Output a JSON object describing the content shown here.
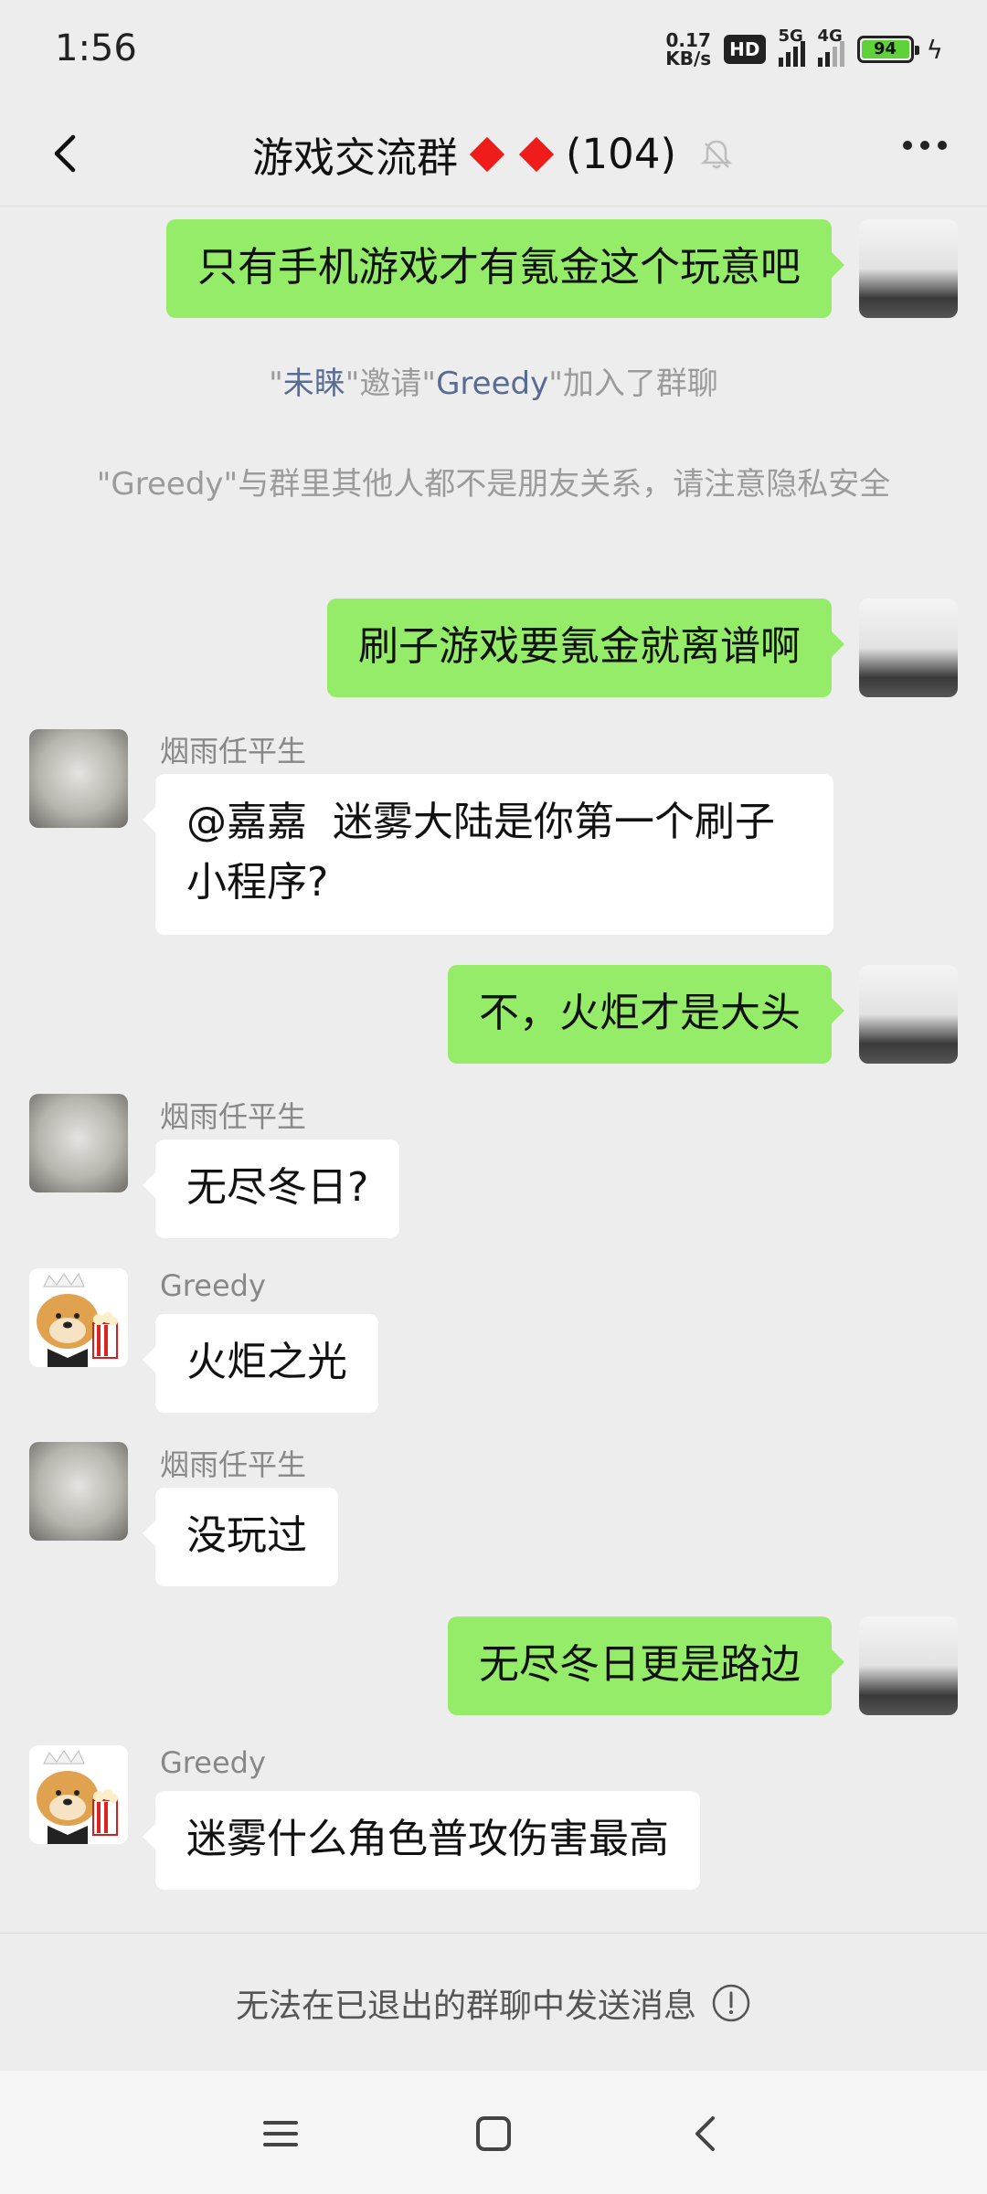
{
  "status": {
    "time": "1:56",
    "net_speed_top": "0.17",
    "net_speed_bottom": "KB/s",
    "hd": "HD",
    "signal1": "5G",
    "signal2": "4G",
    "battery": "94"
  },
  "header": {
    "title_prefix": "游戏交流群",
    "title_count": "(104)",
    "back_icon": "chevron-left-icon",
    "mute_icon": "bell-off-icon",
    "more_icon": "more-dots-icon"
  },
  "messages": {
    "m1": {
      "text": "只有手机游戏才有氪金这个玩意吧"
    },
    "sys1": {
      "q1": "\"",
      "inviter": "未睐",
      "q2": "\"邀请\"",
      "invitee": "Greedy",
      "q3": "\"加入了群聊"
    },
    "sys2": {
      "text": "\"Greedy\"与群里其他人都不是朋友关系，请注意隐私安全"
    },
    "m2": {
      "text": "刷子游戏要氪金就离谱啊"
    },
    "m3": {
      "sender": "烟雨任平生",
      "text": "@嘉嘉  迷雾大陆是你第一个刷子小程序?"
    },
    "m4": {
      "text": "不，火炬才是大头"
    },
    "m5": {
      "sender": "烟雨任平生",
      "text": "无尽冬日?"
    },
    "m6": {
      "sender": "Greedy",
      "text": "火炬之光"
    },
    "m7": {
      "sender": "烟雨任平生",
      "text": "没玩过"
    },
    "m8": {
      "text": "无尽冬日更是路边"
    },
    "m9": {
      "sender": "Greedy",
      "text": "迷雾什么角色普攻伤害最高"
    }
  },
  "footer": {
    "notice": "无法在已退出的群聊中发送消息",
    "info_icon": "info-circle-icon"
  },
  "navbar": {
    "menu_icon": "menu-icon",
    "home_icon": "home-square-icon",
    "back_icon": "back-triangle-icon"
  },
  "colors": {
    "outgoing_bubble": "#95ec69",
    "incoming_bubble": "#ffffff",
    "background": "#ededed",
    "link": "#576b95",
    "diamond": "#ee1b1b"
  }
}
